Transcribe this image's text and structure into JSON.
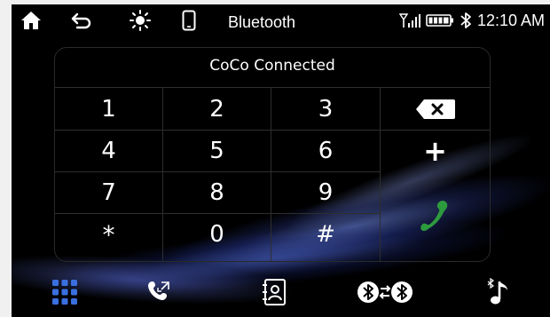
{
  "status_bar": {
    "title": "Bluetooth",
    "time": "12:10 AM",
    "icons": [
      "home-icon",
      "back-icon",
      "brightness-icon",
      "phone-icon",
      "signal-icon",
      "battery-icon",
      "bluetooth-icon"
    ]
  },
  "keypad": {
    "connection_status": "CoCo Connected",
    "keys": [
      "1",
      "2",
      "3",
      "4",
      "5",
      "6",
      "7",
      "8",
      "9",
      "*",
      "0",
      "#"
    ],
    "plus_label": "+"
  },
  "dock": {
    "icons": [
      "keypad-icon",
      "call-history-icon",
      "contacts-icon",
      "bluetooth-pair-icon",
      "bluetooth-audio-icon"
    ]
  },
  "colors": {
    "background": "#000000",
    "call_green": "#2e9a3e",
    "keypad_blue": "#3a6fe0",
    "grid_line": "#2e2e2e"
  }
}
